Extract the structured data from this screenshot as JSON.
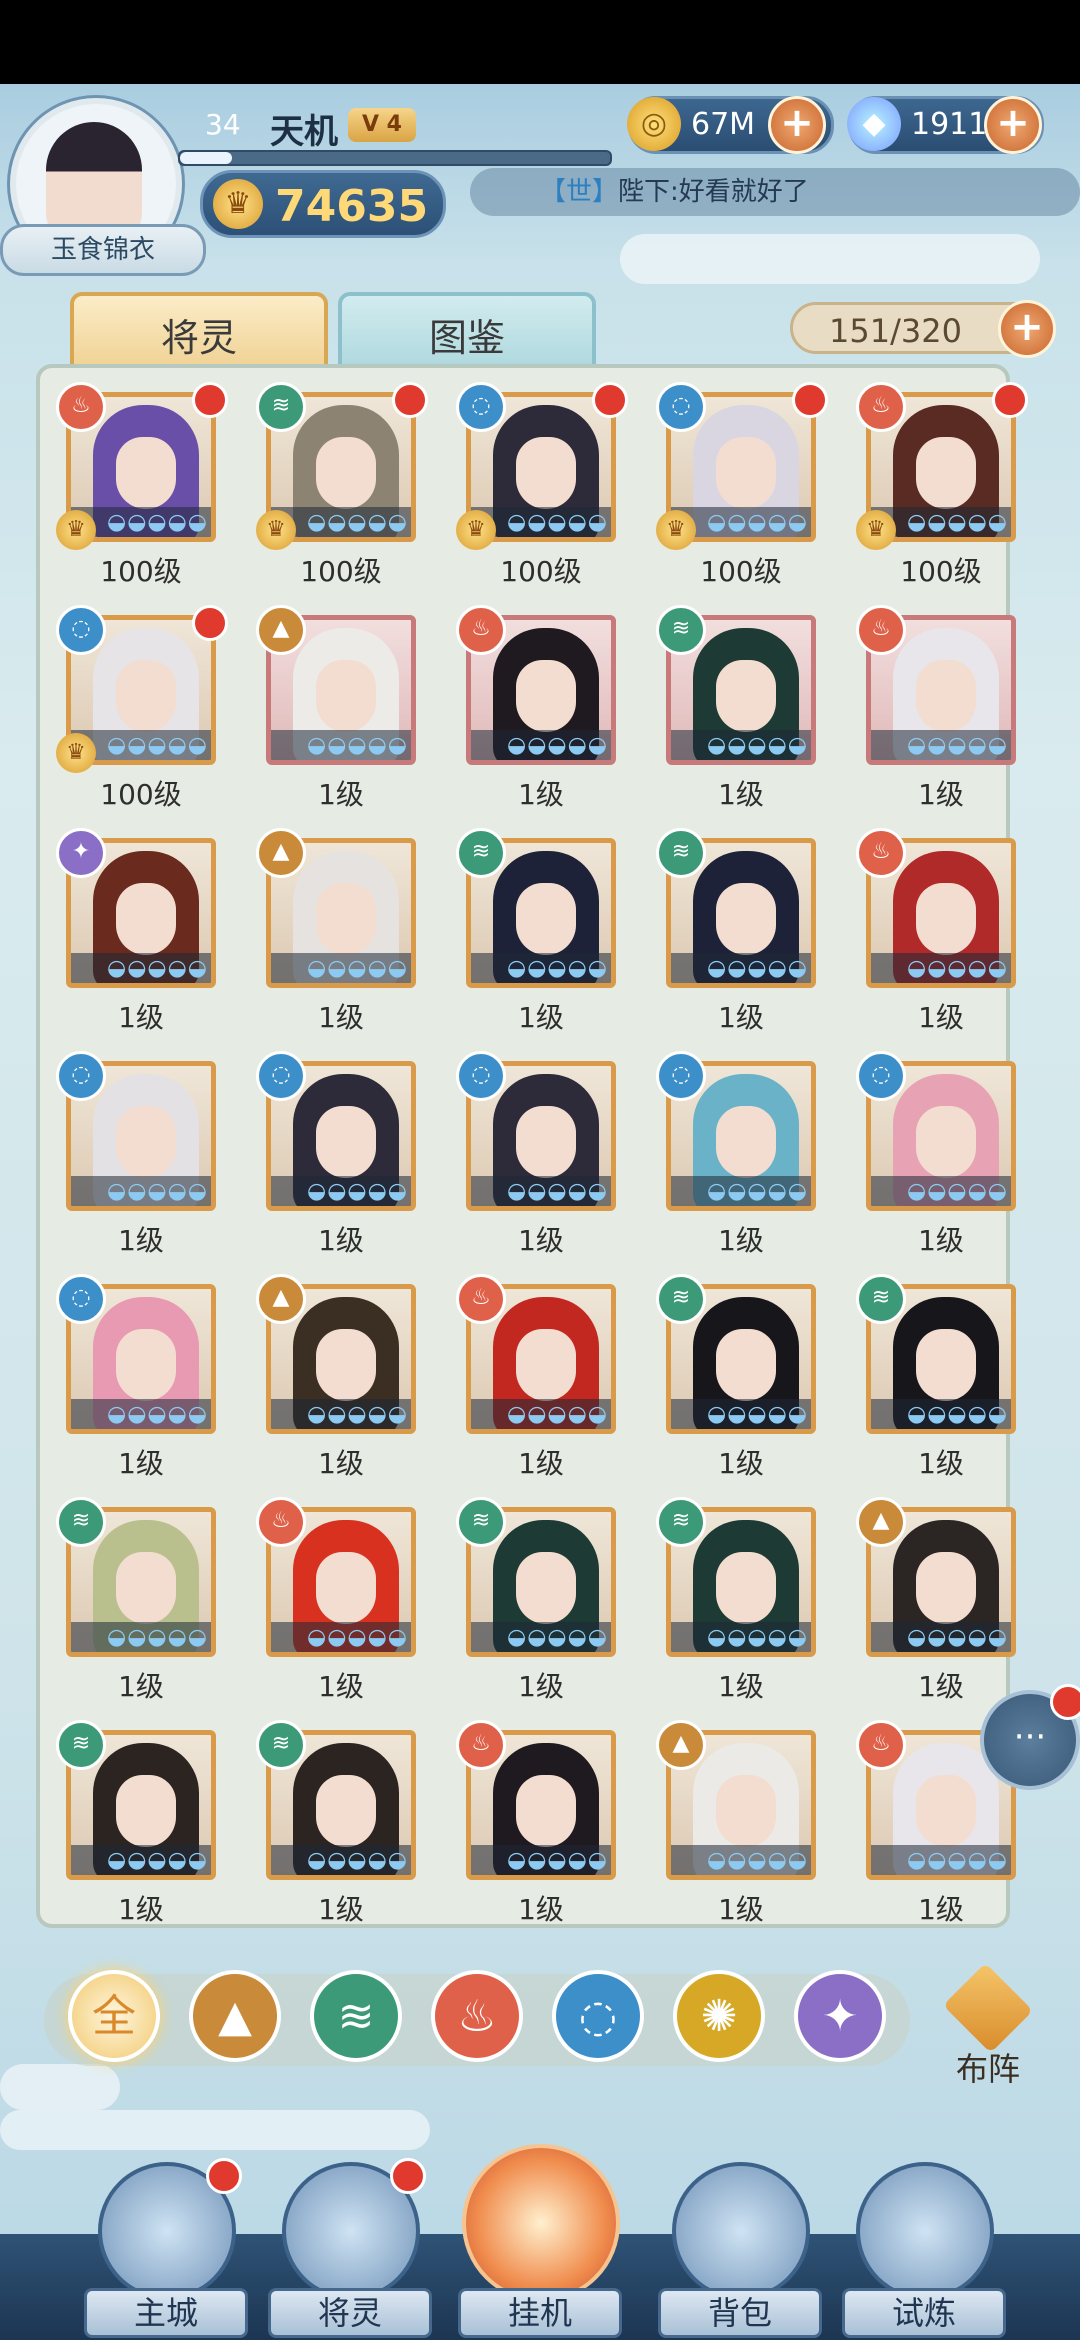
{
  "header": {
    "player_title": "玉食锦衣",
    "level": "34",
    "name": "天机",
    "vip": "V 4",
    "xp_fraction": 0.12,
    "power": "74635",
    "gold": "67M",
    "gems": "1911"
  },
  "chat": {
    "channel": "【世】",
    "message": "陛下:好看就好了"
  },
  "tabs": {
    "active": "将灵",
    "other": "图鉴"
  },
  "roster_count": "151/320",
  "elements": {
    "fire": "#e0614a",
    "wind": "#3c9a78",
    "water": "#3d8fc9",
    "mountain": "#c98a3a",
    "thunder": "#8b6fc6",
    "sun": "#d6a826"
  },
  "cards": [
    {
      "elem": "fire",
      "level": "100级",
      "dot": true,
      "crown": true,
      "hair": "#6a4fa8",
      "frame": "gold"
    },
    {
      "elem": "wind",
      "level": "100级",
      "dot": true,
      "crown": true,
      "hair": "#8c8373",
      "frame": "gold"
    },
    {
      "elem": "water",
      "level": "100级",
      "dot": true,
      "crown": true,
      "hair": "#2d2a3a",
      "frame": "gold"
    },
    {
      "elem": "water",
      "level": "100级",
      "dot": true,
      "crown": true,
      "hair": "#d9d6e2",
      "frame": "gold"
    },
    {
      "elem": "fire",
      "level": "100级",
      "dot": true,
      "crown": true,
      "hair": "#5a2b22",
      "frame": "gold"
    },
    {
      "elem": "water",
      "level": "100级",
      "dot": true,
      "crown": true,
      "hair": "#e6e4e6",
      "frame": "gold"
    },
    {
      "elem": "mountain",
      "level": "1级",
      "dot": false,
      "crown": false,
      "hair": "#ecebe8",
      "frame": "red"
    },
    {
      "elem": "fire",
      "level": "1级",
      "dot": false,
      "crown": false,
      "hair": "#1f1a1f",
      "frame": "red"
    },
    {
      "elem": "wind",
      "level": "1级",
      "dot": false,
      "crown": false,
      "hair": "#1d3b34",
      "frame": "red"
    },
    {
      "elem": "fire",
      "level": "1级",
      "dot": false,
      "crown": false,
      "hair": "#e8e6ea",
      "frame": "red"
    },
    {
      "elem": "thunder",
      "level": "1级",
      "dot": false,
      "crown": false,
      "hair": "#6a2a1e",
      "frame": "gold"
    },
    {
      "elem": "mountain",
      "level": "1级",
      "dot": false,
      "crown": false,
      "hair": "#e6e2e0",
      "frame": "gold"
    },
    {
      "elem": "wind",
      "level": "1级",
      "dot": false,
      "crown": false,
      "hair": "#1e2238",
      "frame": "gold"
    },
    {
      "elem": "wind",
      "level": "1级",
      "dot": false,
      "crown": false,
      "hair": "#1e2238",
      "frame": "gold"
    },
    {
      "elem": "fire",
      "level": "1级",
      "dot": false,
      "crown": false,
      "hair": "#b02a2a",
      "frame": "gold"
    },
    {
      "elem": "water",
      "level": "1级",
      "dot": false,
      "crown": false,
      "hair": "#e3e1e3",
      "frame": "gold"
    },
    {
      "elem": "water",
      "level": "1级",
      "dot": false,
      "crown": false,
      "hair": "#2d2a3a",
      "frame": "gold"
    },
    {
      "elem": "water",
      "level": "1级",
      "dot": false,
      "crown": false,
      "hair": "#2d2a3a",
      "frame": "gold"
    },
    {
      "elem": "water",
      "level": "1级",
      "dot": false,
      "crown": false,
      "hair": "#6ab2c7",
      "frame": "gold"
    },
    {
      "elem": "water",
      "level": "1级",
      "dot": false,
      "crown": false,
      "hair": "#e7a3b4",
      "frame": "gold"
    },
    {
      "elem": "water",
      "level": "1级",
      "dot": false,
      "crown": false,
      "hair": "#e79ab1",
      "frame": "gold"
    },
    {
      "elem": "mountain",
      "level": "1级",
      "dot": false,
      "crown": false,
      "hair": "#3b2e22",
      "frame": "gold"
    },
    {
      "elem": "fire",
      "level": "1级",
      "dot": false,
      "crown": false,
      "hair": "#c2281f",
      "frame": "gold"
    },
    {
      "elem": "wind",
      "level": "1级",
      "dot": false,
      "crown": false,
      "hair": "#17161b",
      "frame": "gold"
    },
    {
      "elem": "wind",
      "level": "1级",
      "dot": false,
      "crown": false,
      "hair": "#17161b",
      "frame": "gold"
    },
    {
      "elem": "wind",
      "level": "1级",
      "dot": false,
      "crown": false,
      "hair": "#b9c08e",
      "frame": "gold"
    },
    {
      "elem": "fire",
      "level": "1级",
      "dot": false,
      "crown": false,
      "hair": "#d8311f",
      "frame": "gold"
    },
    {
      "elem": "wind",
      "level": "1级",
      "dot": false,
      "crown": false,
      "hair": "#1d3b34",
      "frame": "gold"
    },
    {
      "elem": "wind",
      "level": "1级",
      "dot": false,
      "crown": false,
      "hair": "#1d3b34",
      "frame": "gold"
    },
    {
      "elem": "mountain",
      "level": "1级",
      "dot": false,
      "crown": false,
      "hair": "#2b2623",
      "frame": "gold"
    },
    {
      "elem": "wind",
      "level": "1级",
      "dot": false,
      "crown": false,
      "hair": "#2b2420",
      "frame": "gold"
    },
    {
      "elem": "wind",
      "level": "1级",
      "dot": false,
      "crown": false,
      "hair": "#2b2420",
      "frame": "gold"
    },
    {
      "elem": "fire",
      "level": "1级",
      "dot": false,
      "crown": false,
      "hair": "#1f1a1f",
      "frame": "gold"
    },
    {
      "elem": "mountain",
      "level": "1级",
      "dot": false,
      "crown": false,
      "hair": "#eceae6",
      "frame": "gold"
    },
    {
      "elem": "fire",
      "level": "1级",
      "dot": false,
      "crown": false,
      "hair": "#e8e6ea",
      "frame": "gold"
    }
  ],
  "filters": [
    {
      "key": "all",
      "label": "全"
    },
    {
      "key": "mountain",
      "label": ""
    },
    {
      "key": "wind",
      "label": ""
    },
    {
      "key": "fire",
      "label": ""
    },
    {
      "key": "water",
      "label": ""
    },
    {
      "key": "sun",
      "label": ""
    },
    {
      "key": "thunder",
      "label": ""
    }
  ],
  "formation_label": "布阵",
  "nav": [
    {
      "label": "主城",
      "dot": true
    },
    {
      "label": "将灵",
      "dot": true
    },
    {
      "label": "挂机",
      "dot": false
    },
    {
      "label": "背包",
      "dot": false
    },
    {
      "label": "试炼",
      "dot": false
    }
  ]
}
